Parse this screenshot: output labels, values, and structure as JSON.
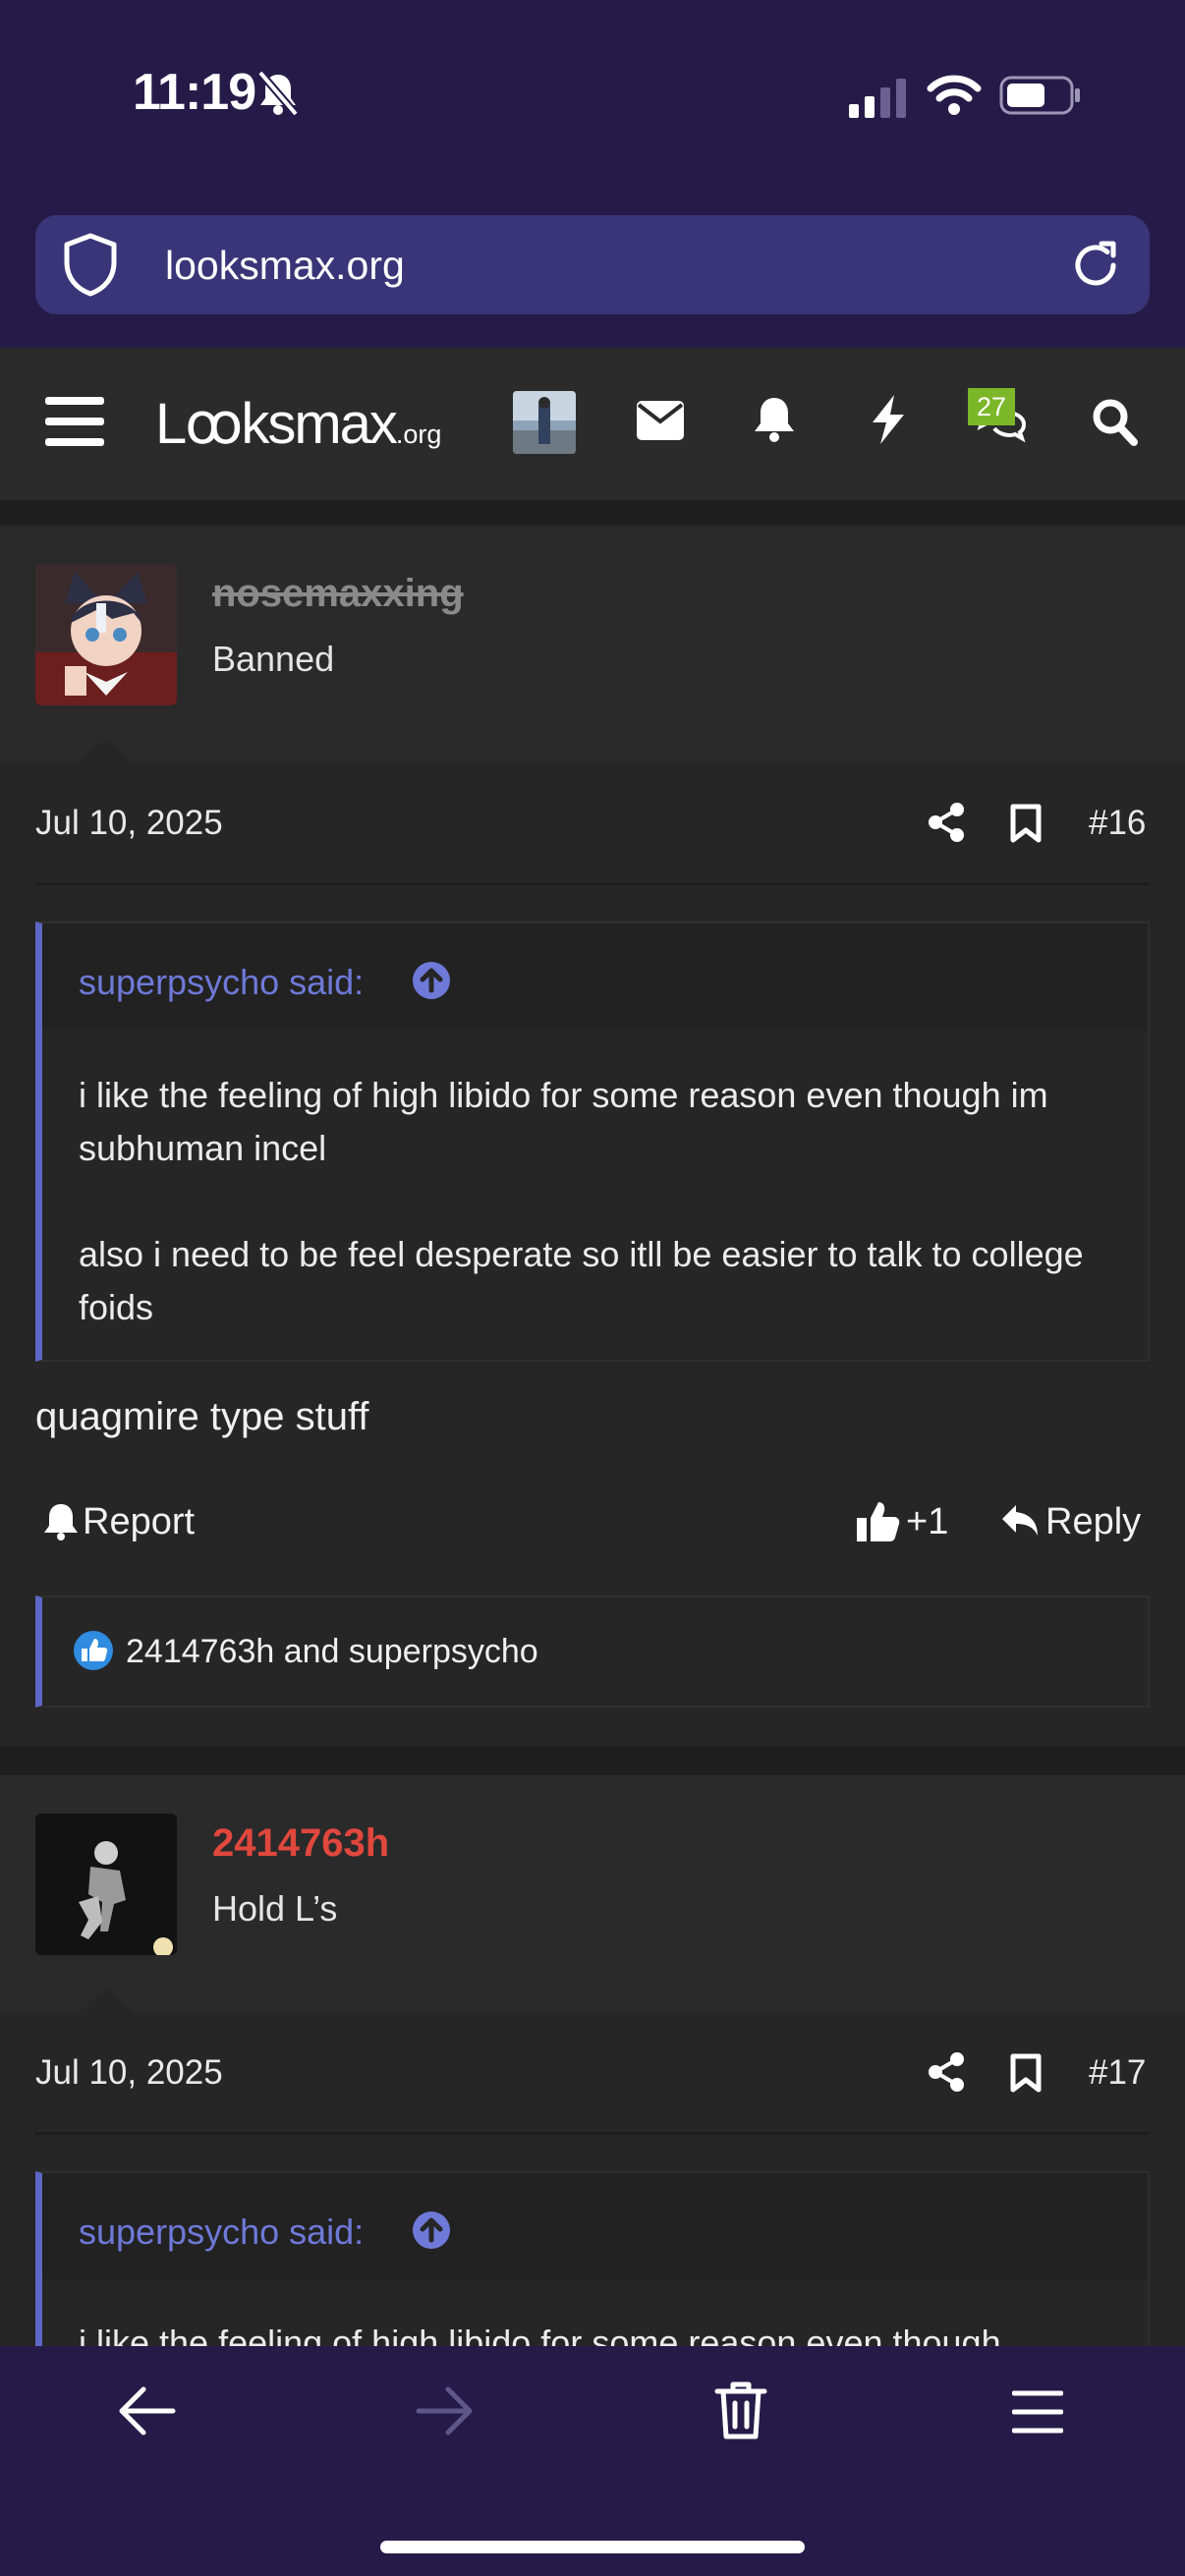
{
  "status_bar": {
    "time": "11:19"
  },
  "browser": {
    "url": "looksmax.org"
  },
  "forum_header": {
    "logo_main": "Lꝏksmax",
    "logo_tld": ".org",
    "conversations_badge": "27"
  },
  "posts": [
    {
      "username": "nosemaxxing",
      "user_title": "Banned",
      "date": "Jul 10, 2025",
      "post_number": "#16",
      "quote": {
        "attribution": "superpsycho said:",
        "paragraphs": [
          "i like the feeling of high libido for some reason even though im subhuman incel",
          "also i need to be feel desperate so itll be easier to talk to college foids"
        ]
      },
      "body": "quagmire type stuff",
      "actions": {
        "report": "Report",
        "like_count": "+1",
        "reply": "Reply"
      },
      "reactions": "2414763h and superpsycho"
    },
    {
      "username": "2414763h",
      "user_title": "Hold L’s",
      "date": "Jul 10, 2025",
      "post_number": "#17",
      "quote": {
        "attribution": "superpsycho said:",
        "paragraphs": [
          "i like the feeling of high libido for some reason even though"
        ]
      }
    }
  ],
  "colors": {
    "browser_chrome": "#261b48",
    "url_bar": "#3a3578",
    "quote_accent": "#5d67c4",
    "username_red": "#e0473d",
    "badge_green": "#7cb72a"
  },
  "icons": [
    "shield-icon",
    "reload-icon",
    "menu-icon",
    "user-avatar-thumb",
    "mail-icon",
    "bell-icon",
    "bolt-icon",
    "chat-icon",
    "search-icon",
    "share-icon",
    "bookmark-icon",
    "quote-up-arrow-icon",
    "report-bell-icon",
    "thumbs-up-icon",
    "reply-icon",
    "like-reaction-icon",
    "back-arrow-icon",
    "forward-arrow-icon",
    "trash-icon",
    "hamburger-icon"
  ]
}
